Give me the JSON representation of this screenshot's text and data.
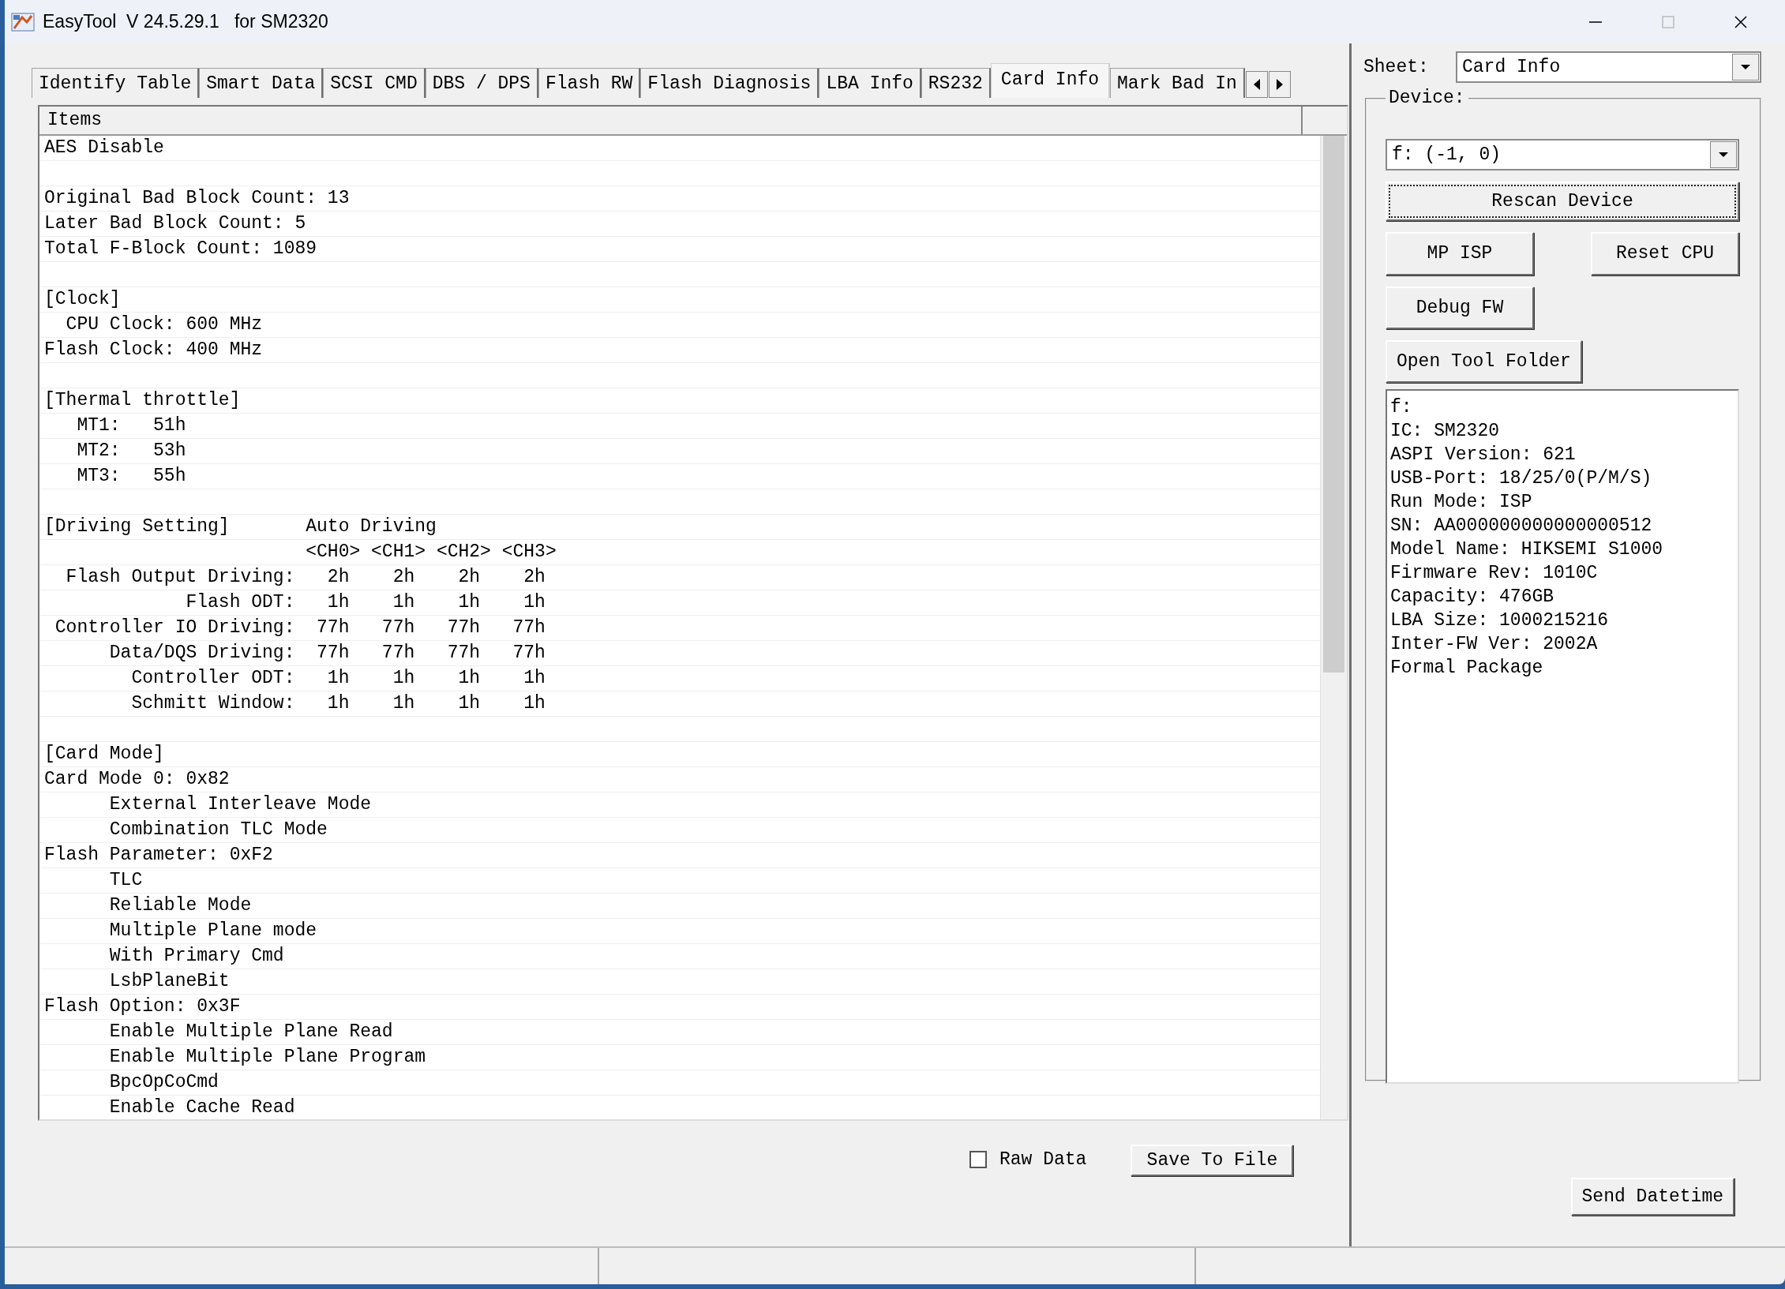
{
  "window": {
    "title": "EasyTool  V 24.5.29.1   for SM2320"
  },
  "tabs": [
    {
      "label": "Identify Table",
      "selected": false
    },
    {
      "label": "Smart Data",
      "selected": false
    },
    {
      "label": "SCSI CMD",
      "selected": false
    },
    {
      "label": "DBS / DPS",
      "selected": false
    },
    {
      "label": "Flash RW",
      "selected": false
    },
    {
      "label": "Flash Diagnosis",
      "selected": false
    },
    {
      "label": "LBA Info",
      "selected": false
    },
    {
      "label": "RS232",
      "selected": false
    },
    {
      "label": "Card Info",
      "selected": true
    },
    {
      "label": "Mark Bad In",
      "selected": false
    }
  ],
  "items_list": {
    "header": "Items",
    "rows": [
      {
        "kind": "text",
        "text": "AES Disable"
      },
      {
        "kind": "blank"
      },
      {
        "kind": "text",
        "text": "Original Bad Block Count: 13"
      },
      {
        "kind": "text",
        "text": "Later Bad Block Count: 5"
      },
      {
        "kind": "text",
        "text": "Total F-Block Count: 1089"
      },
      {
        "kind": "blank"
      },
      {
        "kind": "text",
        "text": "[Clock]"
      },
      {
        "kind": "text",
        "text": "  CPU Clock: 600 MHz"
      },
      {
        "kind": "text",
        "text": "Flash Clock: 400 MHz"
      },
      {
        "kind": "blank"
      },
      {
        "kind": "text",
        "text": "[Thermal throttle]"
      },
      {
        "kind": "text",
        "text": "   MT1:   51h"
      },
      {
        "kind": "text",
        "text": "   MT2:   53h"
      },
      {
        "kind": "text",
        "text": "   MT3:   55h"
      },
      {
        "kind": "blank"
      },
      {
        "kind": "text",
        "text": "[Driving Setting]       Auto Driving"
      },
      {
        "kind": "text",
        "text": "                        <CH0> <CH1> <CH2> <CH3>"
      },
      {
        "kind": "text",
        "text": "  Flash Output Driving:   2h    2h    2h    2h"
      },
      {
        "kind": "text",
        "text": "             Flash ODT:   1h    1h    1h    1h"
      },
      {
        "kind": "text",
        "text": " Controller IO Driving:  77h   77h   77h   77h"
      },
      {
        "kind": "text",
        "text": "      Data/DQS Driving:  77h   77h   77h   77h"
      },
      {
        "kind": "text",
        "text": "        Controller ODT:   1h    1h    1h    1h"
      },
      {
        "kind": "text",
        "text": "        Schmitt Window:   1h    1h    1h    1h"
      },
      {
        "kind": "blank"
      },
      {
        "kind": "text",
        "text": "[Card Mode]"
      },
      {
        "kind": "text",
        "text": "Card Mode 0: 0x82"
      },
      {
        "kind": "text",
        "text": "      External Interleave Mode"
      },
      {
        "kind": "text",
        "text": "      Combination TLC Mode"
      },
      {
        "kind": "text",
        "text": "Flash Parameter: 0xF2"
      },
      {
        "kind": "text",
        "text": "      TLC"
      },
      {
        "kind": "text",
        "text": "      Reliable Mode"
      },
      {
        "kind": "text",
        "text": "      Multiple Plane mode"
      },
      {
        "kind": "text",
        "text": "      With Primary Cmd"
      },
      {
        "kind": "text",
        "text": "      LsbPlaneBit"
      },
      {
        "kind": "text",
        "text": "Flash Option: 0x3F"
      },
      {
        "kind": "text",
        "text": "      Enable Multiple Plane Read"
      },
      {
        "kind": "text",
        "text": "      Enable Multiple Plane Program"
      },
      {
        "kind": "text",
        "text": "      BpcOpCoCmd"
      },
      {
        "kind": "text",
        "text": "      Enable Cache Read"
      }
    ]
  },
  "raw_data": {
    "label": "Raw Data",
    "checked": false
  },
  "save_button": "Save To File",
  "sheet": {
    "label": "Sheet:",
    "value": "Card Info"
  },
  "device": {
    "label": "Device:",
    "value": "f: (-1, 0)",
    "button_rows": [
      [
        {
          "label": "Rescan Device",
          "focused": true
        }
      ],
      [
        {
          "label": "MP ISP",
          "focused": false
        },
        {
          "label": "Reset CPU",
          "focused": false
        }
      ],
      [
        {
          "label": "Debug FW",
          "focused": false
        }
      ],
      [
        {
          "label": "Open Tool Folder",
          "focused": false
        }
      ]
    ],
    "info": [
      "f:",
      "IC: SM2320",
      "ASPI Version: 621",
      "USB-Port: 18/25/0(P/M/S)",
      "Run Mode: ISP",
      "SN: AA000000000000000512",
      "Model Name: HIKSEMI S1000",
      "Firmware Rev: 1010C",
      "Capacity: 476GB",
      "LBA Size: 1000215216",
      "Inter-FW Ver: 2002A",
      "Formal Package"
    ]
  },
  "send_datetime": "Send Datetime"
}
